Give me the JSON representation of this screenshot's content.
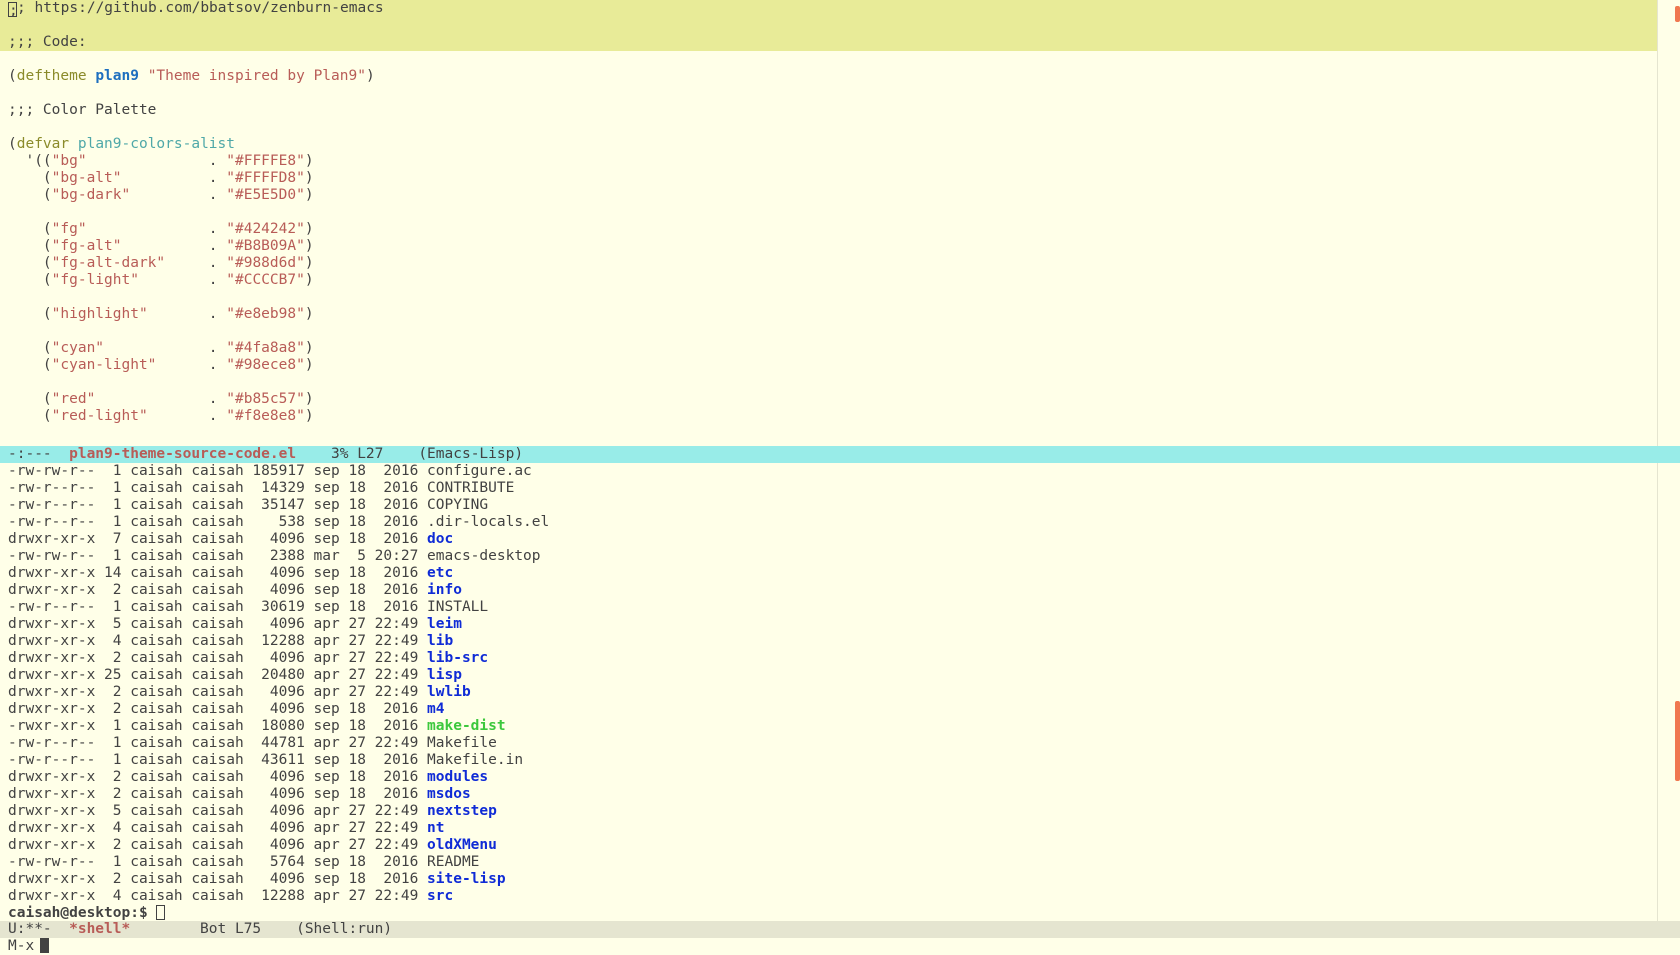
{
  "source_buffer": {
    "lines": [
      {
        "parts": [
          {
            "t": "cursor",
            "v": ";"
          },
          {
            "t": "cmt",
            "v": "; https://github.com/bbatsov/zenburn-emacs"
          }
        ],
        "hl": true
      },
      {
        "parts": [],
        "hl": true
      },
      {
        "parts": [
          {
            "t": "cmt",
            "v": ";;; Code:"
          }
        ],
        "hl": true
      },
      {
        "parts": []
      },
      {
        "parts": [
          {
            "t": "lparen",
            "v": "("
          },
          {
            "t": "kw",
            "v": "deftheme"
          },
          {
            "t": "lparen",
            "v": " "
          },
          {
            "t": "fname",
            "v": "plan9"
          },
          {
            "t": "lparen",
            "v": " "
          },
          {
            "t": "str",
            "v": "\"Theme inspired by Plan9\""
          },
          {
            "t": "lparen",
            "v": ")"
          }
        ]
      },
      {
        "parts": []
      },
      {
        "parts": [
          {
            "t": "cmt",
            "v": ";;; Color Palette"
          }
        ]
      },
      {
        "parts": []
      },
      {
        "parts": [
          {
            "t": "lparen",
            "v": "("
          },
          {
            "t": "kw",
            "v": "defvar"
          },
          {
            "t": "lparen",
            "v": " "
          },
          {
            "t": "var",
            "v": "plan9-colors-alist"
          }
        ]
      },
      {
        "parts": [
          {
            "t": "lparen",
            "v": "  '(("
          },
          {
            "t": "str",
            "v": "\"bg\""
          },
          {
            "t": "lparen",
            "v": "              . "
          },
          {
            "t": "str",
            "v": "\"#FFFFE8\""
          },
          {
            "t": "lparen",
            "v": ")"
          }
        ]
      },
      {
        "parts": [
          {
            "t": "lparen",
            "v": "    ("
          },
          {
            "t": "str",
            "v": "\"bg-alt\""
          },
          {
            "t": "lparen",
            "v": "          . "
          },
          {
            "t": "str",
            "v": "\"#FFFFD8\""
          },
          {
            "t": "lparen",
            "v": ")"
          }
        ]
      },
      {
        "parts": [
          {
            "t": "lparen",
            "v": "    ("
          },
          {
            "t": "str",
            "v": "\"bg-dark\""
          },
          {
            "t": "lparen",
            "v": "         . "
          },
          {
            "t": "str",
            "v": "\"#E5E5D0\""
          },
          {
            "t": "lparen",
            "v": ")"
          }
        ]
      },
      {
        "parts": []
      },
      {
        "parts": [
          {
            "t": "lparen",
            "v": "    ("
          },
          {
            "t": "str",
            "v": "\"fg\""
          },
          {
            "t": "lparen",
            "v": "              . "
          },
          {
            "t": "str",
            "v": "\"#424242\""
          },
          {
            "t": "lparen",
            "v": ")"
          }
        ]
      },
      {
        "parts": [
          {
            "t": "lparen",
            "v": "    ("
          },
          {
            "t": "str",
            "v": "\"fg-alt\""
          },
          {
            "t": "lparen",
            "v": "          . "
          },
          {
            "t": "str",
            "v": "\"#B8B09A\""
          },
          {
            "t": "lparen",
            "v": ")"
          }
        ]
      },
      {
        "parts": [
          {
            "t": "lparen",
            "v": "    ("
          },
          {
            "t": "str",
            "v": "\"fg-alt-dark\""
          },
          {
            "t": "lparen",
            "v": "     . "
          },
          {
            "t": "str",
            "v": "\"#988d6d\""
          },
          {
            "t": "lparen",
            "v": ")"
          }
        ]
      },
      {
        "parts": [
          {
            "t": "lparen",
            "v": "    ("
          },
          {
            "t": "str",
            "v": "\"fg-light\""
          },
          {
            "t": "lparen",
            "v": "        . "
          },
          {
            "t": "str",
            "v": "\"#CCCCB7\""
          },
          {
            "t": "lparen",
            "v": ")"
          }
        ]
      },
      {
        "parts": []
      },
      {
        "parts": [
          {
            "t": "lparen",
            "v": "    ("
          },
          {
            "t": "str",
            "v": "\"highlight\""
          },
          {
            "t": "lparen",
            "v": "       . "
          },
          {
            "t": "str",
            "v": "\"#e8eb98\""
          },
          {
            "t": "lparen",
            "v": ")"
          }
        ]
      },
      {
        "parts": []
      },
      {
        "parts": [
          {
            "t": "lparen",
            "v": "    ("
          },
          {
            "t": "str",
            "v": "\"cyan\""
          },
          {
            "t": "lparen",
            "v": "            . "
          },
          {
            "t": "str",
            "v": "\"#4fa8a8\""
          },
          {
            "t": "lparen",
            "v": ")"
          }
        ]
      },
      {
        "parts": [
          {
            "t": "lparen",
            "v": "    ("
          },
          {
            "t": "str",
            "v": "\"cyan-light\""
          },
          {
            "t": "lparen",
            "v": "      . "
          },
          {
            "t": "str",
            "v": "\"#98ece8\""
          },
          {
            "t": "lparen",
            "v": ")"
          }
        ]
      },
      {
        "parts": []
      },
      {
        "parts": [
          {
            "t": "lparen",
            "v": "    ("
          },
          {
            "t": "str",
            "v": "\"red\""
          },
          {
            "t": "lparen",
            "v": "             . "
          },
          {
            "t": "str",
            "v": "\"#b85c57\""
          },
          {
            "t": "lparen",
            "v": ")"
          }
        ]
      },
      {
        "parts": [
          {
            "t": "lparen",
            "v": "    ("
          },
          {
            "t": "str",
            "v": "\"red-light\""
          },
          {
            "t": "lparen",
            "v": "       . "
          },
          {
            "t": "str",
            "v": "\"#f8e8e8\""
          },
          {
            "t": "lparen",
            "v": ")"
          }
        ]
      }
    ]
  },
  "modeline_source": {
    "status": "-:---  ",
    "buffer": "plan9-theme-source-code.el",
    "position": "    3% L27    ",
    "mode": "(Emacs-Lisp)"
  },
  "shell_buffer": {
    "listing": [
      {
        "perm": "-rw-rw-r--",
        "links": " 1",
        "size": "185917",
        "date": "sep 18  2016",
        "name": "configure.ac",
        "kind": "file"
      },
      {
        "perm": "-rw-r--r--",
        "links": " 1",
        "size": " 14329",
        "date": "sep 18  2016",
        "name": "CONTRIBUTE",
        "kind": "file"
      },
      {
        "perm": "-rw-r--r--",
        "links": " 1",
        "size": " 35147",
        "date": "sep 18  2016",
        "name": "COPYING",
        "kind": "file"
      },
      {
        "perm": "-rw-r--r--",
        "links": " 1",
        "size": "   538",
        "date": "sep 18  2016",
        "name": ".dir-locals.el",
        "kind": "file"
      },
      {
        "perm": "drwxr-xr-x",
        "links": " 7",
        "size": "  4096",
        "date": "sep 18  2016",
        "name": "doc",
        "kind": "dir"
      },
      {
        "perm": "-rw-rw-r--",
        "links": " 1",
        "size": "  2388",
        "date": "mar  5 20:27",
        "name": "emacs-desktop",
        "kind": "file"
      },
      {
        "perm": "drwxr-xr-x",
        "links": "14",
        "size": "  4096",
        "date": "sep 18  2016",
        "name": "etc",
        "kind": "dir"
      },
      {
        "perm": "drwxr-xr-x",
        "links": " 2",
        "size": "  4096",
        "date": "sep 18  2016",
        "name": "info",
        "kind": "dir"
      },
      {
        "perm": "-rw-r--r--",
        "links": " 1",
        "size": " 30619",
        "date": "sep 18  2016",
        "name": "INSTALL",
        "kind": "file"
      },
      {
        "perm": "drwxr-xr-x",
        "links": " 5",
        "size": "  4096",
        "date": "apr 27 22:49",
        "name": "leim",
        "kind": "dir"
      },
      {
        "perm": "drwxr-xr-x",
        "links": " 4",
        "size": " 12288",
        "date": "apr 27 22:49",
        "name": "lib",
        "kind": "dir"
      },
      {
        "perm": "drwxr-xr-x",
        "links": " 2",
        "size": "  4096",
        "date": "apr 27 22:49",
        "name": "lib-src",
        "kind": "dir"
      },
      {
        "perm": "drwxr-xr-x",
        "links": "25",
        "size": " 20480",
        "date": "apr 27 22:49",
        "name": "lisp",
        "kind": "dir"
      },
      {
        "perm": "drwxr-xr-x",
        "links": " 2",
        "size": "  4096",
        "date": "apr 27 22:49",
        "name": "lwlib",
        "kind": "dir"
      },
      {
        "perm": "drwxr-xr-x",
        "links": " 2",
        "size": "  4096",
        "date": "sep 18  2016",
        "name": "m4",
        "kind": "dir"
      },
      {
        "perm": "-rwxr-xr-x",
        "links": " 1",
        "size": " 18080",
        "date": "sep 18  2016",
        "name": "make-dist",
        "kind": "exe"
      },
      {
        "perm": "-rw-r--r--",
        "links": " 1",
        "size": " 44781",
        "date": "apr 27 22:49",
        "name": "Makefile",
        "kind": "file"
      },
      {
        "perm": "-rw-r--r--",
        "links": " 1",
        "size": " 43611",
        "date": "sep 18  2016",
        "name": "Makefile.in",
        "kind": "file"
      },
      {
        "perm": "drwxr-xr-x",
        "links": " 2",
        "size": "  4096",
        "date": "sep 18  2016",
        "name": "modules",
        "kind": "dir"
      },
      {
        "perm": "drwxr-xr-x",
        "links": " 2",
        "size": "  4096",
        "date": "sep 18  2016",
        "name": "msdos",
        "kind": "dir"
      },
      {
        "perm": "drwxr-xr-x",
        "links": " 5",
        "size": "  4096",
        "date": "apr 27 22:49",
        "name": "nextstep",
        "kind": "dir"
      },
      {
        "perm": "drwxr-xr-x",
        "links": " 4",
        "size": "  4096",
        "date": "apr 27 22:49",
        "name": "nt",
        "kind": "dir"
      },
      {
        "perm": "drwxr-xr-x",
        "links": " 2",
        "size": "  4096",
        "date": "apr 27 22:49",
        "name": "oldXMenu",
        "kind": "dir"
      },
      {
        "perm": "-rw-rw-r--",
        "links": " 1",
        "size": "  5764",
        "date": "sep 18  2016",
        "name": "README",
        "kind": "file"
      },
      {
        "perm": "drwxr-xr-x",
        "links": " 2",
        "size": "  4096",
        "date": "sep 18  2016",
        "name": "site-lisp",
        "kind": "dir"
      },
      {
        "perm": "drwxr-xr-x",
        "links": " 4",
        "size": " 12288",
        "date": "apr 27 22:49",
        "name": "src",
        "kind": "dir"
      }
    ],
    "owner": "caisah",
    "group": "caisah",
    "prompt": "caisah@desktop:$ "
  },
  "modeline_shell": {
    "status": "U:**-  ",
    "buffer": "*shell*",
    "position": "        Bot L75    ",
    "mode": "(Shell:run)"
  },
  "minibuffer": {
    "text": "M-x"
  },
  "colors": {
    "bg": "#FFFFE8",
    "highlight": "#E8EB98",
    "modeline_active": "#98ECE8",
    "modeline_inactive": "#E5E5D0",
    "string": "#B85C57",
    "keyword": "#8B8B2A",
    "function": "#1E6FBF",
    "variable": "#4FA8A8",
    "directory": "#0F2BD6",
    "executable": "#3CC83C"
  }
}
